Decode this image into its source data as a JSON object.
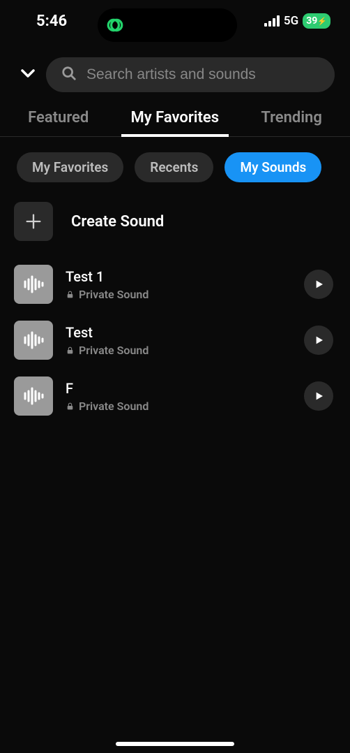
{
  "status": {
    "time": "5:46",
    "network": "5G",
    "battery": "39"
  },
  "search": {
    "placeholder": "Search artists and sounds"
  },
  "top_tabs": [
    {
      "label": "Featured",
      "active": false
    },
    {
      "label": "My Favorites",
      "active": true
    },
    {
      "label": "Trending",
      "active": false
    }
  ],
  "filters": [
    {
      "label": "My Favorites",
      "active": false
    },
    {
      "label": "Recents",
      "active": false
    },
    {
      "label": "My Sounds",
      "active": true
    }
  ],
  "create": {
    "label": "Create Sound"
  },
  "sounds": [
    {
      "title": "Test 1",
      "subtitle": "Private Sound"
    },
    {
      "title": "Test",
      "subtitle": "Private Sound"
    },
    {
      "title": "F",
      "subtitle": "Private Sound"
    }
  ]
}
